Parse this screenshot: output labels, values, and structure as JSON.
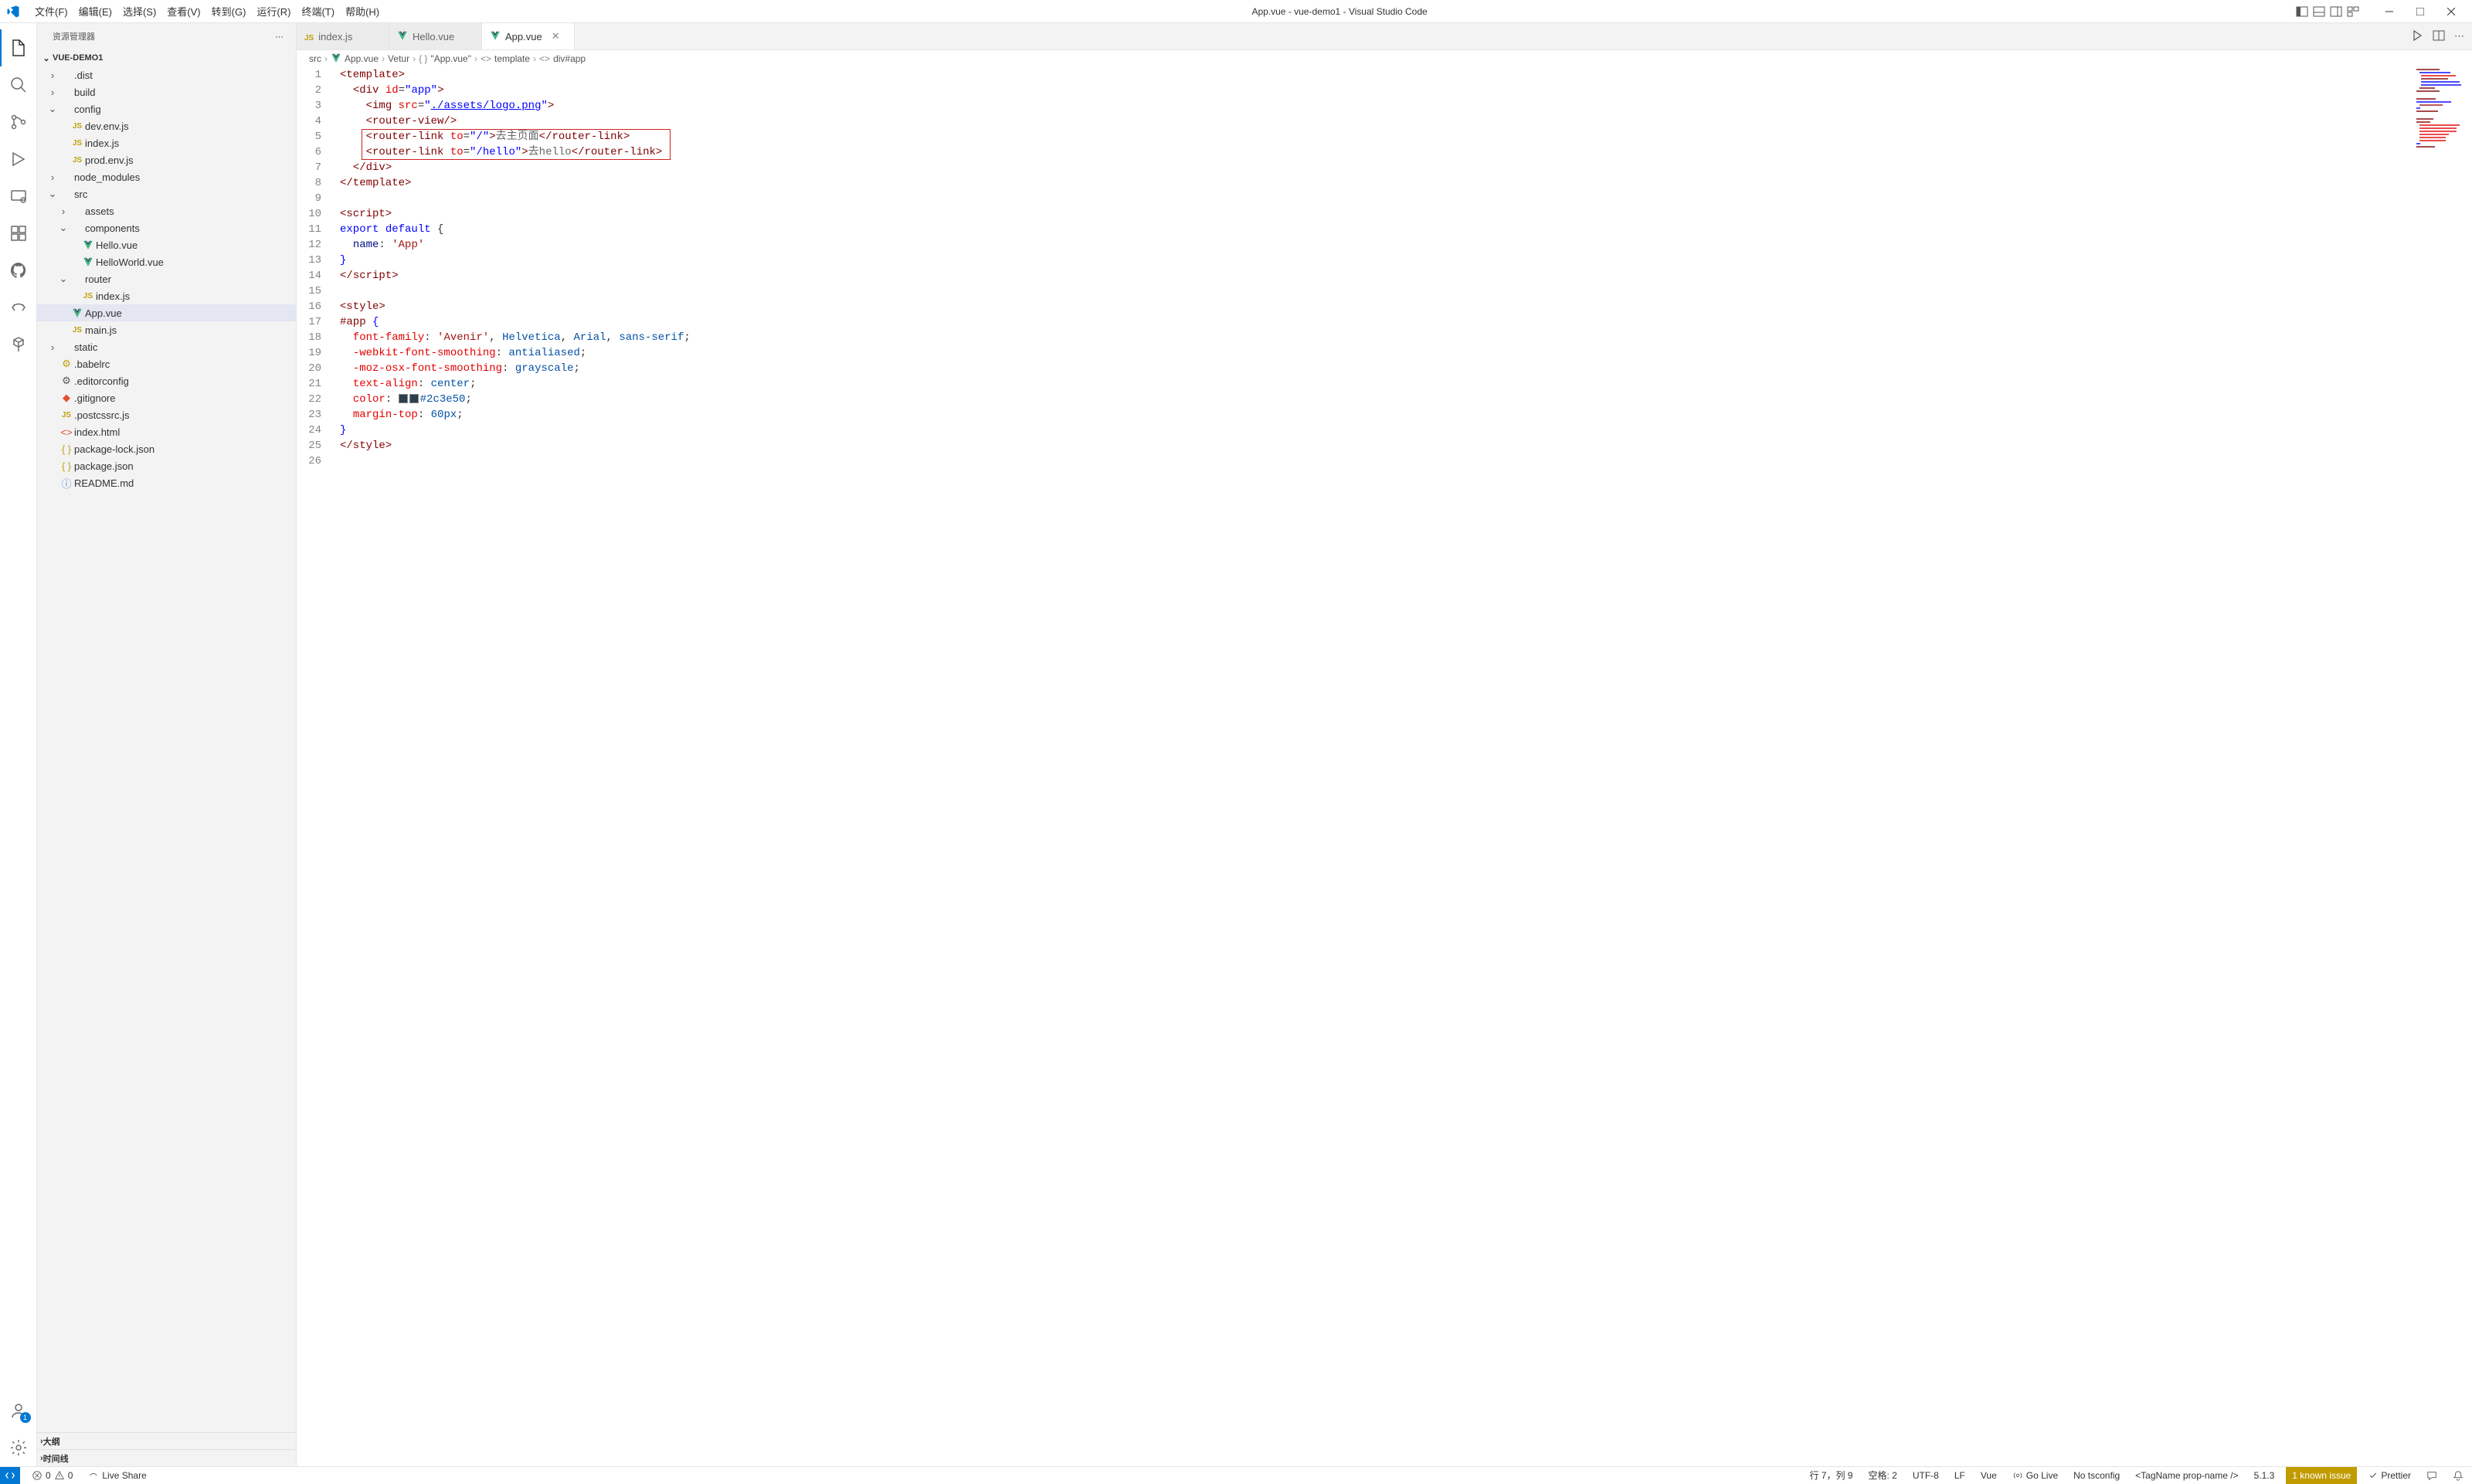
{
  "window": {
    "title": "App.vue - vue-demo1 - Visual Studio Code"
  },
  "menu": {
    "items": [
      "文件(F)",
      "编辑(E)",
      "选择(S)",
      "查看(V)",
      "转到(G)",
      "运行(R)",
      "终端(T)",
      "帮助(H)"
    ]
  },
  "sidebar": {
    "title": "资源管理器",
    "project": "VUE-DEMO1",
    "outline": "大纲",
    "timeline": "时间线",
    "tree": [
      {
        "depth": 0,
        "kind": "folder",
        "open": false,
        "label": ".dist"
      },
      {
        "depth": 0,
        "kind": "folder",
        "open": false,
        "label": "build"
      },
      {
        "depth": 0,
        "kind": "folder",
        "open": true,
        "label": "config"
      },
      {
        "depth": 1,
        "kind": "js",
        "label": "dev.env.js"
      },
      {
        "depth": 1,
        "kind": "js",
        "label": "index.js"
      },
      {
        "depth": 1,
        "kind": "js",
        "label": "prod.env.js"
      },
      {
        "depth": 0,
        "kind": "folder",
        "open": false,
        "label": "node_modules"
      },
      {
        "depth": 0,
        "kind": "folder",
        "open": true,
        "label": "src"
      },
      {
        "depth": 1,
        "kind": "folder",
        "open": false,
        "label": "assets"
      },
      {
        "depth": 1,
        "kind": "folder",
        "open": true,
        "label": "components"
      },
      {
        "depth": 2,
        "kind": "vue",
        "label": "Hello.vue"
      },
      {
        "depth": 2,
        "kind": "vue",
        "label": "HelloWorld.vue"
      },
      {
        "depth": 1,
        "kind": "folder",
        "open": true,
        "label": "router"
      },
      {
        "depth": 2,
        "kind": "js",
        "label": "index.js"
      },
      {
        "depth": 1,
        "kind": "vue",
        "label": "App.vue",
        "selected": true
      },
      {
        "depth": 1,
        "kind": "js",
        "label": "main.js"
      },
      {
        "depth": 0,
        "kind": "folder",
        "open": false,
        "label": "static"
      },
      {
        "depth": 0,
        "kind": "babel",
        "label": ".babelrc"
      },
      {
        "depth": 0,
        "kind": "gear",
        "label": ".editorconfig"
      },
      {
        "depth": 0,
        "kind": "git",
        "label": ".gitignore"
      },
      {
        "depth": 0,
        "kind": "js",
        "label": ".postcssrc.js"
      },
      {
        "depth": 0,
        "kind": "html",
        "label": "index.html"
      },
      {
        "depth": 0,
        "kind": "brace",
        "label": "package-lock.json"
      },
      {
        "depth": 0,
        "kind": "brace",
        "label": "package.json"
      },
      {
        "depth": 0,
        "kind": "info",
        "label": "README.md"
      }
    ]
  },
  "activity": {
    "account_badge": "1"
  },
  "tabs": [
    {
      "kind": "js",
      "label": "index.js",
      "active": false
    },
    {
      "kind": "vue",
      "label": "Hello.vue",
      "active": false
    },
    {
      "kind": "vue",
      "label": "App.vue",
      "active": true
    }
  ],
  "breadcrumbs": [
    "src",
    "App.vue",
    "Vetur",
    "\"App.vue\"",
    "template",
    "div#app"
  ],
  "editor": {
    "line_count": 26,
    "highlight_lines": [
      5,
      6
    ],
    "lines": [
      [
        [
          "tag",
          "<template>"
        ]
      ],
      [
        [
          "ind",
          "  "
        ],
        [
          "tag",
          "<div "
        ],
        [
          "attr",
          "id"
        ],
        [
          "punct",
          "="
        ],
        [
          "str",
          "\"app\""
        ],
        [
          "tag",
          ">"
        ]
      ],
      [
        [
          "ind",
          "    "
        ],
        [
          "tag",
          "<img "
        ],
        [
          "attr",
          "src"
        ],
        [
          "punct",
          "="
        ],
        [
          "str",
          "\""
        ],
        [
          "link",
          "./assets/logo.png"
        ],
        [
          "str",
          "\""
        ],
        [
          "tag",
          ">"
        ]
      ],
      [
        [
          "ind",
          "    "
        ],
        [
          "tag",
          "<router-view/>"
        ]
      ],
      [
        [
          "ind",
          "    "
        ],
        [
          "tag",
          "<router-link "
        ],
        [
          "attr",
          "to"
        ],
        [
          "punct",
          "="
        ],
        [
          "str",
          "\"/\""
        ],
        [
          "tag",
          ">"
        ],
        [
          "txt",
          "去主页面"
        ],
        [
          "tag",
          "</router-link>"
        ]
      ],
      [
        [
          "ind",
          "    "
        ],
        [
          "tag",
          "<router-link "
        ],
        [
          "attr",
          "to"
        ],
        [
          "punct",
          "="
        ],
        [
          "str",
          "\"/hello\""
        ],
        [
          "tag",
          ">"
        ],
        [
          "txt",
          "去hello"
        ],
        [
          "tag",
          "</router-link>"
        ]
      ],
      [
        [
          "ind",
          "  "
        ],
        [
          "tag",
          "</div>"
        ]
      ],
      [
        [
          "tag",
          "</template>"
        ]
      ],
      [],
      [
        [
          "tag",
          "<script>"
        ]
      ],
      [
        [
          "kw",
          "export "
        ],
        [
          "kw2",
          "default"
        ],
        [
          "punct",
          " {"
        ]
      ],
      [
        [
          "ind",
          "  "
        ],
        [
          "name",
          "name"
        ],
        [
          "punct",
          ": "
        ],
        [
          "strg",
          "'App'"
        ]
      ],
      [
        [
          "brace",
          "}"
        ]
      ],
      [
        [
          "tag",
          "</"
        ],
        [
          "tag",
          "script>"
        ]
      ],
      [],
      [
        [
          "tag",
          "<style>"
        ]
      ],
      [
        [
          "sel",
          "#app "
        ],
        [
          "brace",
          "{"
        ]
      ],
      [
        [
          "ind",
          "  "
        ],
        [
          "cssprop",
          "font-family"
        ],
        [
          "punct",
          ": "
        ],
        [
          "strg",
          "'Avenir'"
        ],
        [
          "punct",
          ", "
        ],
        [
          "cssval",
          "Helvetica"
        ],
        [
          "punct",
          ", "
        ],
        [
          "cssval",
          "Arial"
        ],
        [
          "punct",
          ", "
        ],
        [
          "cssval",
          "sans-serif"
        ],
        [
          "punct",
          ";"
        ]
      ],
      [
        [
          "ind",
          "  "
        ],
        [
          "cssprop",
          "-webkit-font-smoothing"
        ],
        [
          "punct",
          ": "
        ],
        [
          "cssval",
          "antialiased"
        ],
        [
          "punct",
          ";"
        ]
      ],
      [
        [
          "ind",
          "  "
        ],
        [
          "cssprop",
          "-moz-osx-font-smoothing"
        ],
        [
          "punct",
          ": "
        ],
        [
          "cssval",
          "grayscale"
        ],
        [
          "punct",
          ";"
        ]
      ],
      [
        [
          "ind",
          "  "
        ],
        [
          "cssprop",
          "text-align"
        ],
        [
          "punct",
          ": "
        ],
        [
          "cssval",
          "center"
        ],
        [
          "punct",
          ";"
        ]
      ],
      [
        [
          "ind",
          "  "
        ],
        [
          "cssprop",
          "color"
        ],
        [
          "punct",
          ": "
        ],
        [
          "swatch",
          "#2c3e50"
        ],
        [
          "cssval",
          "#2c3e50"
        ],
        [
          "punct",
          ";"
        ]
      ],
      [
        [
          "ind",
          "  "
        ],
        [
          "cssprop",
          "margin-top"
        ],
        [
          "punct",
          ": "
        ],
        [
          "cssval",
          "60px"
        ],
        [
          "punct",
          ";"
        ]
      ],
      [
        [
          "brace",
          "}"
        ]
      ],
      [
        [
          "tag",
          "</style>"
        ]
      ],
      []
    ]
  },
  "status": {
    "errors": "0",
    "warnings": "0",
    "live_share": "Live Share",
    "cursor": "行 7，列 9",
    "spaces": "空格: 2",
    "encoding": "UTF-8",
    "eol": "LF",
    "lang": "Vue",
    "golive": "Go Live",
    "tsconfig": "No tsconfig",
    "tagname": "<TagName prop-name />",
    "version": "5.1.3",
    "known_issue": "1 known issue",
    "prettier": "Prettier"
  }
}
